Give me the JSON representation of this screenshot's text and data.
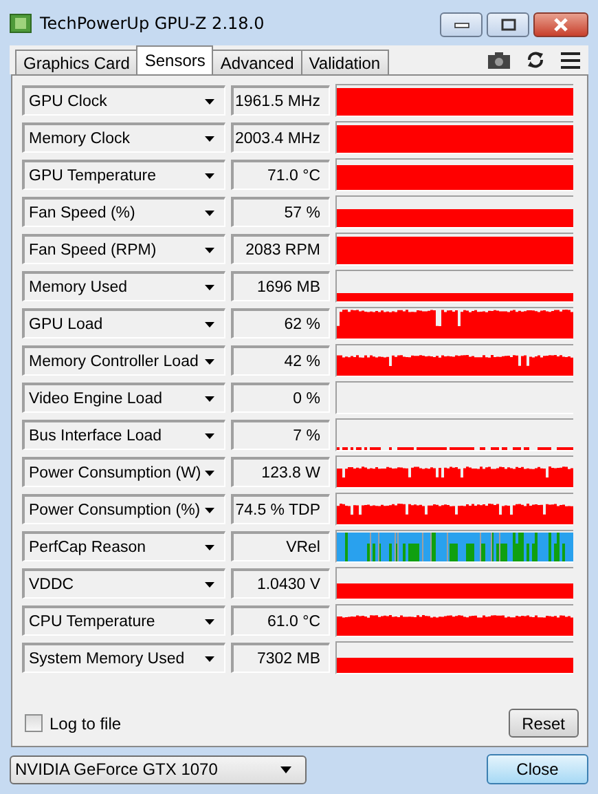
{
  "window": {
    "title": "TechPowerUp GPU-Z 2.18.0"
  },
  "tabs": [
    {
      "label": "Graphics Card",
      "selected": false
    },
    {
      "label": "Sensors",
      "selected": true
    },
    {
      "label": "Advanced",
      "selected": false
    },
    {
      "label": "Validation",
      "selected": false
    }
  ],
  "sensors": [
    {
      "name": "GPU Clock",
      "value": "1961.5 MHz",
      "kind": "full"
    },
    {
      "name": "Memory Clock",
      "value": "2003.4 MHz",
      "kind": "full"
    },
    {
      "name": "GPU Temperature",
      "value": "71.0 °C",
      "kind": "high"
    },
    {
      "name": "Fan Speed (%)",
      "value": "57 %",
      "kind": "mid"
    },
    {
      "name": "Fan Speed (RPM)",
      "value": "2083 RPM",
      "kind": "full"
    },
    {
      "name": "Memory Used",
      "value": "1696 MB",
      "kind": "low"
    },
    {
      "name": "GPU Load",
      "value": "62 %",
      "kind": "busy"
    },
    {
      "name": "Memory Controller Load",
      "value": "42 %",
      "kind": "noisy"
    },
    {
      "name": "Video Engine Load",
      "value": "0 %",
      "kind": "empty"
    },
    {
      "name": "Bus Interface Load",
      "value": "7 %",
      "kind": "sparse"
    },
    {
      "name": "Power Consumption (W)",
      "value": "123.8 W",
      "kind": "noisy"
    },
    {
      "name": "Power Consumption (%)",
      "value": "74.5 % TDP",
      "kind": "noisy"
    },
    {
      "name": "PerfCap Reason",
      "value": "VRel",
      "kind": "perfcap"
    },
    {
      "name": "VDDC",
      "value": "1.0430 V",
      "kind": "bottom"
    },
    {
      "name": "CPU Temperature",
      "value": "61.0 °C",
      "kind": "noisy"
    },
    {
      "name": "System Memory Used",
      "value": "7302 MB",
      "kind": "bottom"
    }
  ],
  "log_to_file": {
    "label": "Log to file",
    "checked": false
  },
  "reset_button": "Reset",
  "device_select": {
    "value": "NVIDIA GeForce GTX 1070"
  },
  "close_button": "Close"
}
